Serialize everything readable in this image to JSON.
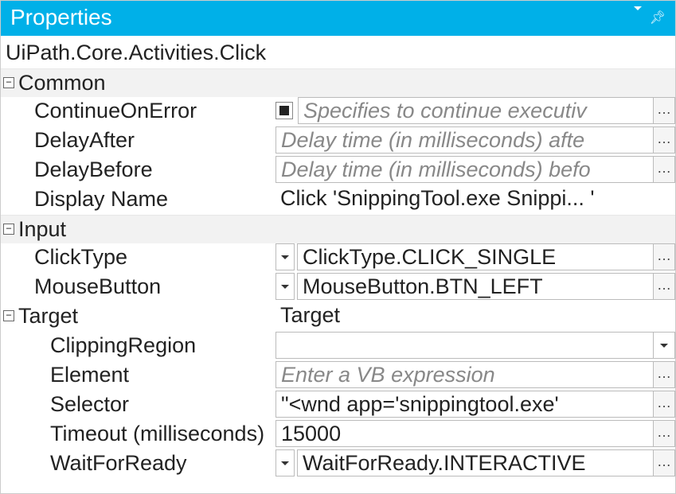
{
  "panel": {
    "title": "Properties"
  },
  "activity": "UiPath.Core.Activities.Click",
  "sections": {
    "common": {
      "label": "Common",
      "continueOnError": {
        "label": "ContinueOnError",
        "placeholder": "Specifies to continue executiv"
      },
      "delayAfter": {
        "label": "DelayAfter",
        "placeholder": "Delay time (in milliseconds) afte"
      },
      "delayBefore": {
        "label": "DelayBefore",
        "placeholder": "Delay time (in milliseconds) befo"
      },
      "displayName": {
        "label": "Display Name",
        "value": "Click 'SnippingTool.exe Snippi... '"
      }
    },
    "input": {
      "label": "Input",
      "clickType": {
        "label": "ClickType",
        "value": "ClickType.CLICK_SINGLE"
      },
      "mouseButton": {
        "label": "MouseButton",
        "value": "MouseButton.BTN_LEFT"
      }
    },
    "target": {
      "label": "Target",
      "value": "Target",
      "clippingRegion": {
        "label": "ClippingRegion",
        "value": ""
      },
      "element": {
        "label": "Element",
        "placeholder": "Enter a VB expression"
      },
      "selector": {
        "label": "Selector",
        "value": "\"<wnd app='snippingtool.exe' "
      },
      "timeout": {
        "label": "Timeout (milliseconds)",
        "value": "15000"
      },
      "waitForReady": {
        "label": "WaitForReady",
        "value": "WaitForReady.INTERACTIVE"
      }
    }
  }
}
